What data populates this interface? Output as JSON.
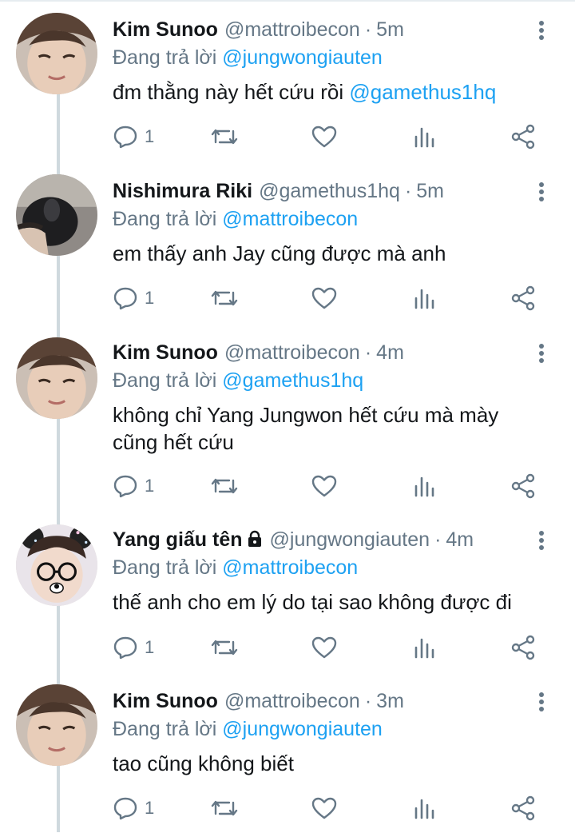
{
  "colors": {
    "accent": "#1da1f2",
    "muted": "#657786",
    "text": "#14171a",
    "thread_line": "#cfd9de"
  },
  "tweets": [
    {
      "name": "Kim Sunoo",
      "handle": "@mattroibecon",
      "dot": "·",
      "time": "5m",
      "reply_prefix": "Đang trả lời",
      "reply_to": "@jungwongiauten",
      "text": "đm thằng này hết cứu rồi",
      "text_mention": "@gamethus1hq",
      "reply_count": "1",
      "avatar": "avatar-kim-sunoo",
      "locked": false
    },
    {
      "name": "Nishimura Riki",
      "handle": "@gamethus1hq",
      "dot": "·",
      "time": "5m",
      "reply_prefix": "Đang trả lời",
      "reply_to": "@mattroibecon",
      "text": "em thấy anh Jay cũng được mà anh",
      "text_mention": "",
      "reply_count": "1",
      "avatar": "avatar-nishimura-riki",
      "locked": false
    },
    {
      "name": "Kim Sunoo",
      "handle": "@mattroibecon",
      "dot": "·",
      "time": "4m",
      "reply_prefix": "Đang trả lời",
      "reply_to": "@gamethus1hq",
      "text": "không chỉ Yang Jungwon hết cứu mà mày cũng hết cứu",
      "text_mention": "",
      "reply_count": "1",
      "avatar": "avatar-kim-sunoo",
      "locked": false
    },
    {
      "name": "Yang giấu tên",
      "handle": "@jungwongiauten",
      "dot": "·",
      "time": "4m",
      "reply_prefix": "Đang trả lời",
      "reply_to": "@mattroibecon",
      "text": "thế anh cho em lý do tại sao không được đi",
      "text_mention": "",
      "reply_count": "1",
      "avatar": "avatar-yang",
      "locked": true
    },
    {
      "name": "Kim Sunoo",
      "handle": "@mattroibecon",
      "dot": "·",
      "time": "3m",
      "reply_prefix": "Đang trả lời",
      "reply_to": "@jungwongiauten",
      "text": "tao cũng không biết",
      "text_mention": "",
      "reply_count": "1",
      "avatar": "avatar-kim-sunoo",
      "locked": false
    }
  ],
  "icons": {
    "reply": "reply-icon",
    "retweet": "retweet-icon",
    "like": "heart-icon",
    "analytics": "analytics-icon",
    "share": "share-icon",
    "more": "more-vertical-icon",
    "lock": "lock-icon"
  }
}
